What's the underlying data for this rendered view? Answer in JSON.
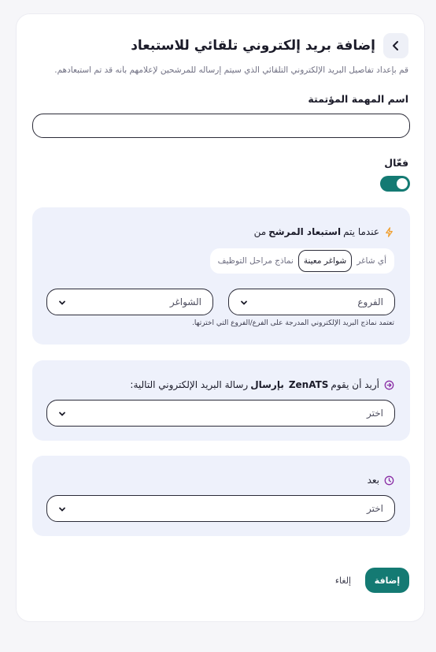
{
  "header": {
    "title": "إضافة بريد إلكتروني تلقائي للاستبعاد",
    "subtitle": "قم بإعداد تفاصيل البريد الإلكتروني التلقائي الذي سيتم إرساله للمرشحين لإعلامهم بأنه قد تم استبعادهم."
  },
  "task_name": {
    "label": "اسم المهمة المؤتمتة",
    "value": "",
    "placeholder": ""
  },
  "active": {
    "label": "فعّال",
    "enabled": true
  },
  "trigger": {
    "prefix": "عندما يتم",
    "bold": "استبعاد المرشح",
    "suffix": "من",
    "options": [
      "أي شاغر",
      "شواغر معينة",
      "نماذج مراحل التوظيف"
    ],
    "selected": "شواغر معينة",
    "branches_select": "الفروع",
    "vacancies_select": "الشواغر",
    "hint": "تعتمد نماذج البريد الإلكتروني المدرجة على الفرع/الفروع التي اخترتها."
  },
  "action": {
    "prefix": "أريد أن يقوم",
    "brand": "ZenATS",
    "verb": "بإرسال",
    "suffix": "رسالة البريد الإلكتروني التالية:",
    "select": "اختر"
  },
  "delay": {
    "label": "بعد",
    "select": "اختر"
  },
  "footer": {
    "add": "إضافة",
    "cancel": "إلغاء"
  },
  "colors": {
    "accent": "#147a73",
    "panel": "#eef1fb",
    "page": "#f6f6f9"
  },
  "icons": {
    "back": "chevron-left-icon",
    "trigger": "lightning-icon",
    "action": "arrow-circle-right-icon",
    "delay": "clock-icon",
    "dropdown": "chevron-down-icon"
  }
}
